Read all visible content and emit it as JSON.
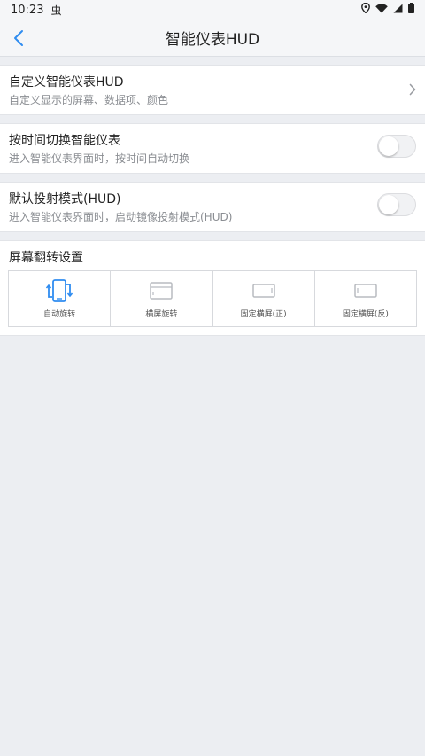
{
  "status_bar": {
    "time": "10:23",
    "notif_glyph": "虫"
  },
  "nav": {
    "title": "智能仪表HUD"
  },
  "settings": {
    "custom": {
      "title": "自定义智能仪表HUD",
      "subtitle": "自定义显示的屏幕、数据项、颜色"
    },
    "time_switch": {
      "title": "按时间切换智能仪表",
      "subtitle": "进入智能仪表界面时，按时间自动切换",
      "enabled": false
    },
    "hud_default": {
      "title": "默认投射模式(HUD)",
      "subtitle": "进入智能仪表界面时，启动镜像投射模式(HUD)",
      "enabled": false
    }
  },
  "flip": {
    "title": "屏幕翻转设置",
    "options": [
      {
        "label": "自动旋转",
        "icon": "auto-rotate-icon",
        "selected": true
      },
      {
        "label": "横屏旋转",
        "icon": "landscape-rotate-icon",
        "selected": false
      },
      {
        "label": "固定横屏(正)",
        "icon": "landscape-fixed-icon",
        "selected": false
      },
      {
        "label": "固定横屏(反)",
        "icon": "landscape-reverse-icon",
        "selected": false
      }
    ]
  },
  "colors": {
    "accent": "#2f8cf0",
    "inactive_icon": "#b8bbc0",
    "background": "#eceef2"
  }
}
